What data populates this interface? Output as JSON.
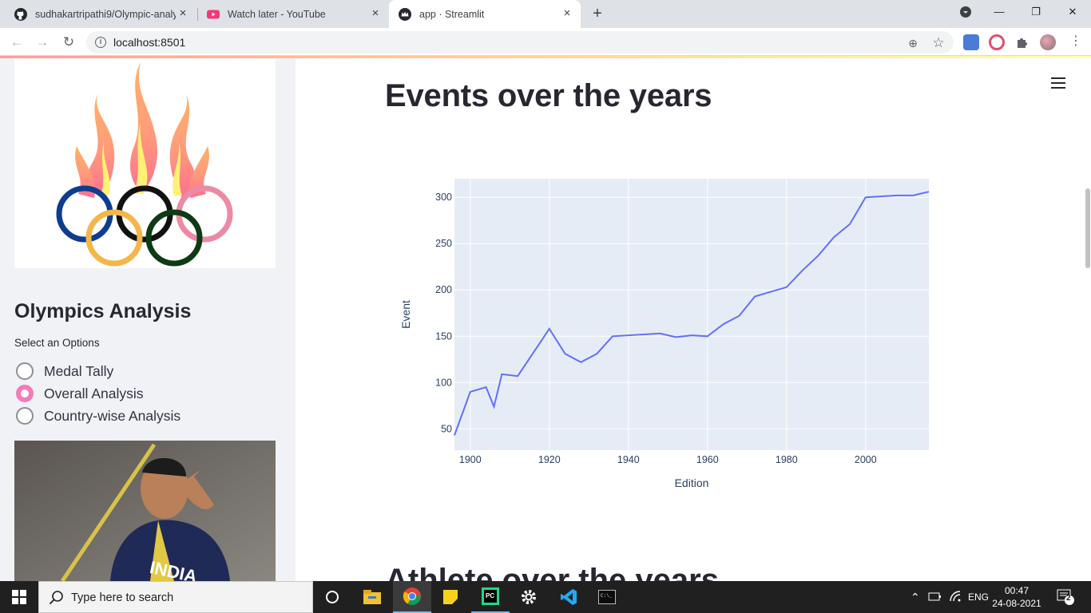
{
  "browser": {
    "tabs": [
      {
        "title": "sudhakartripathi9/Olympic-analy"
      },
      {
        "title": "Watch later - YouTube"
      },
      {
        "title": "app · Streamlit"
      }
    ],
    "url": "localhost:8501",
    "close_glyph": "×",
    "new_tab_glyph": "+",
    "minimize_glyph": "—",
    "maximize_glyph": "❐",
    "window_close_glyph": "✕",
    "back_glyph": "←",
    "forward_glyph": "→",
    "reload_glyph": "↻",
    "info_glyph": "i",
    "zoom_glyph": "⊕",
    "star_glyph": "☆"
  },
  "sidebar": {
    "title": "Olympics Analysis",
    "select_label": "Select an Options",
    "options": [
      "Medal Tally",
      "Overall Analysis",
      "Country-wise Analysis"
    ],
    "selected": "Overall Analysis",
    "photo_text": "INDIA"
  },
  "main": {
    "heading": "Events over the years",
    "next_heading": "Athlete over the years"
  },
  "chart_data": {
    "type": "line",
    "xlabel": "Edition",
    "ylabel": "Event",
    "xlim": [
      1896,
      2016
    ],
    "ylim": [
      27,
      320
    ],
    "x_ticks": [
      1900,
      1920,
      1940,
      1960,
      1980,
      2000
    ],
    "y_ticks": [
      50,
      100,
      150,
      200,
      250,
      300
    ],
    "line_color": "#636efa",
    "plot_bg": "#e5ecf6",
    "series": [
      {
        "x": [
          1896,
          1900,
          1904,
          1906,
          1908,
          1912,
          1920,
          1924,
          1928,
          1932,
          1936,
          1948,
          1952,
          1956,
          1960,
          1964,
          1968,
          1972,
          1976,
          1980,
          1984,
          1988,
          1992,
          1996,
          2000,
          2004,
          2008,
          2012,
          2016
        ],
        "y": [
          43,
          90,
          95,
          74,
          109,
          107,
          158,
          131,
          122,
          131,
          150,
          153,
          149,
          151,
          150,
          163,
          172,
          193,
          198,
          203,
          221,
          237,
          257,
          271,
          300,
          301,
          302,
          302,
          306
        ]
      }
    ]
  },
  "taskbar": {
    "search_placeholder": "Type here to search",
    "language": "ENG",
    "time": "00:47",
    "date": "24-08-2021",
    "notification_count": "2"
  }
}
